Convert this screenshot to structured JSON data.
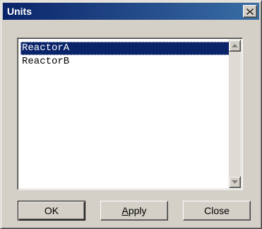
{
  "window": {
    "title": "Units",
    "close_icon": "close-icon"
  },
  "unit_list": {
    "items": [
      {
        "label": "ReactorA",
        "selected": true
      },
      {
        "label": "ReactorB",
        "selected": false
      }
    ],
    "scroll_up_icon": "scroll-up-arrow-icon",
    "scroll_down_icon": "scroll-down-arrow-icon"
  },
  "buttons": {
    "ok_label": "OK",
    "apply_mnemonic": "A",
    "apply_rest": "pply",
    "close_label": "Close"
  },
  "colors": {
    "title_bar": "#0a246a",
    "title_bar_gradient_end": "#3a6ea5",
    "selection": "#0a246a",
    "face": "#d4d0c8"
  }
}
